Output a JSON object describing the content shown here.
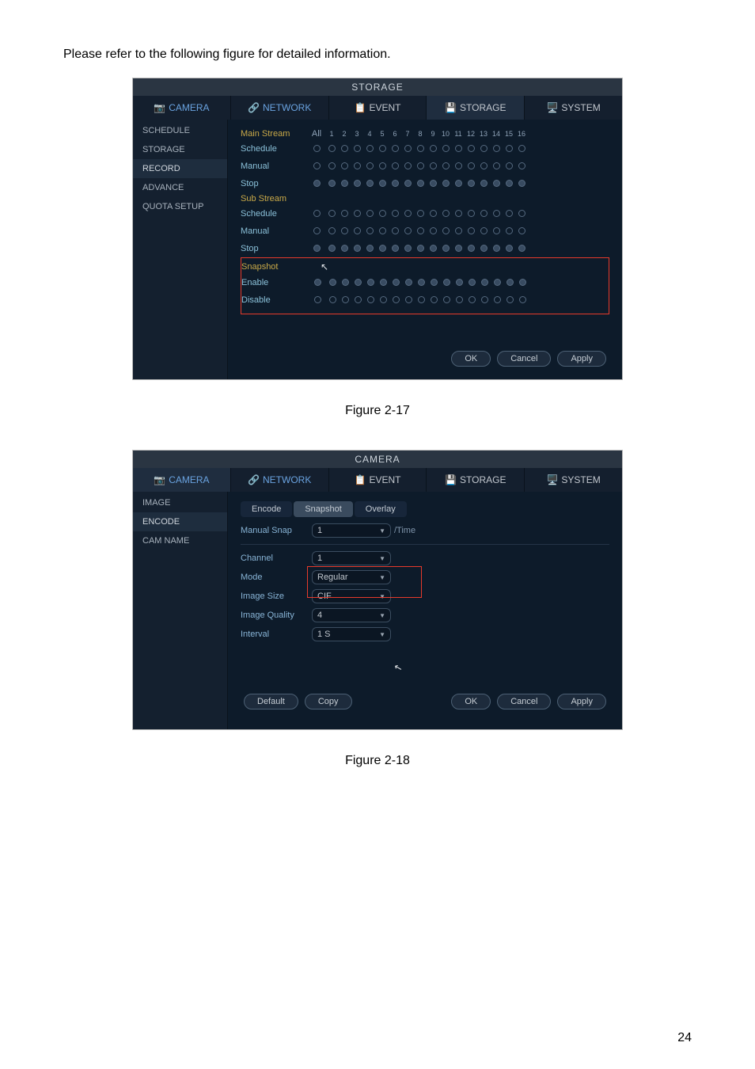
{
  "intro": "Please refer to the following figure for detailed information.",
  "fig1": {
    "title": "STORAGE",
    "tabs": {
      "camera": "CAMERA",
      "network": "NETWORK",
      "event": "EVENT",
      "storage": "STORAGE",
      "system": "SYSTEM"
    },
    "sidebar": [
      "SCHEDULE",
      "STORAGE",
      "RECORD",
      "ADVANCE",
      "QUOTA SETUP"
    ],
    "sidebar_active": 2,
    "cols_all": "All",
    "cols": [
      "1",
      "2",
      "3",
      "4",
      "5",
      "6",
      "7",
      "8",
      "9",
      "10",
      "11",
      "12",
      "13",
      "14",
      "15",
      "16"
    ],
    "main_stream_label": "Main Stream",
    "sub_stream_label": "Sub Stream",
    "snapshot_label": "Snapshot",
    "rows_main": [
      {
        "label": "Schedule",
        "all": "empty",
        "dots": "empty"
      },
      {
        "label": "Manual",
        "all": "empty",
        "dots": "empty"
      },
      {
        "label": "Stop",
        "all": "filled",
        "dots": "filled"
      }
    ],
    "rows_sub": [
      {
        "label": "Schedule",
        "all": "empty",
        "dots": "empty"
      },
      {
        "label": "Manual",
        "all": "empty",
        "dots": "empty"
      },
      {
        "label": "Stop",
        "all": "filled",
        "dots": "filled"
      }
    ],
    "rows_snap": [
      {
        "label": "Enable",
        "all": "filled",
        "dots": "filled"
      },
      {
        "label": "Disable",
        "all": "empty",
        "dots": "empty"
      }
    ],
    "buttons": {
      "ok": "OK",
      "cancel": "Cancel",
      "apply": "Apply"
    }
  },
  "captions": {
    "fig1": "Figure 2-17",
    "fig2": "Figure 2-18"
  },
  "fig2": {
    "title": "CAMERA",
    "tabs": {
      "camera": "CAMERA",
      "network": "NETWORK",
      "event": "EVENT",
      "storage": "STORAGE",
      "system": "SYSTEM"
    },
    "sidebar": [
      "IMAGE",
      "ENCODE",
      "CAM NAME"
    ],
    "sidebar_active": 1,
    "inner_tabs": {
      "encode": "Encode",
      "snapshot": "Snapshot",
      "overlay": "Overlay"
    },
    "fields": {
      "manual_snap_label": "Manual Snap",
      "manual_snap_val": "1",
      "manual_snap_suffix": "/Time",
      "channel_label": "Channel",
      "channel_val": "1",
      "mode_label": "Mode",
      "mode_val": "Regular",
      "image_size_label": "Image Size",
      "image_size_val": "CIF",
      "image_quality_label": "Image Quality",
      "image_quality_val": "4",
      "interval_label": "Interval",
      "interval_val": "1 S"
    },
    "buttons": {
      "default": "Default",
      "copy": "Copy",
      "ok": "OK",
      "cancel": "Cancel",
      "apply": "Apply"
    }
  },
  "page_number": "24"
}
